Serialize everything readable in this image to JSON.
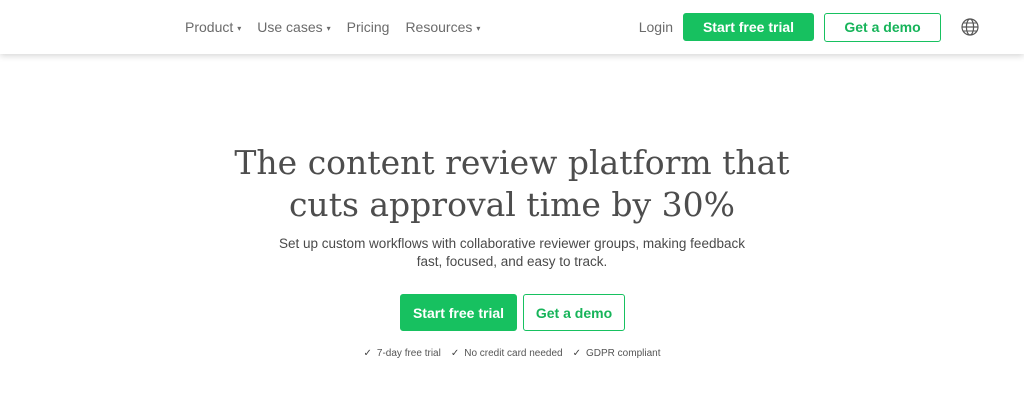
{
  "nav": {
    "items": [
      {
        "label": "Product",
        "has_dropdown": true
      },
      {
        "label": "Use cases",
        "has_dropdown": true
      },
      {
        "label": "Pricing",
        "has_dropdown": false
      },
      {
        "label": "Resources",
        "has_dropdown": true
      }
    ],
    "caret_glyph": "▾",
    "login_label": "Login",
    "trial_label": "Start free trial",
    "demo_label": "Get a demo",
    "language_icon": "globe-icon"
  },
  "hero": {
    "title_lines": [
      "The content review platform that",
      "cuts approval time by 30%"
    ],
    "subtitle_lines": [
      "Set up custom workflows with collaborative reviewer groups, making feedback",
      "fast, focused, and easy to track."
    ],
    "trial_label": "Start free trial",
    "demo_label": "Get a demo",
    "perks": [
      {
        "icon": "checkmark-icon",
        "glyph": "✓",
        "label": "7-day free trial"
      },
      {
        "icon": "checkmark-icon",
        "glyph": "✓",
        "label": "No credit card needed"
      },
      {
        "icon": "checkmark-icon",
        "glyph": "✓",
        "label": "GDPR compliant"
      }
    ]
  },
  "colors": {
    "accent": "#17c160",
    "text": "#4d4d4d",
    "nav_text": "#6b6b6b"
  }
}
